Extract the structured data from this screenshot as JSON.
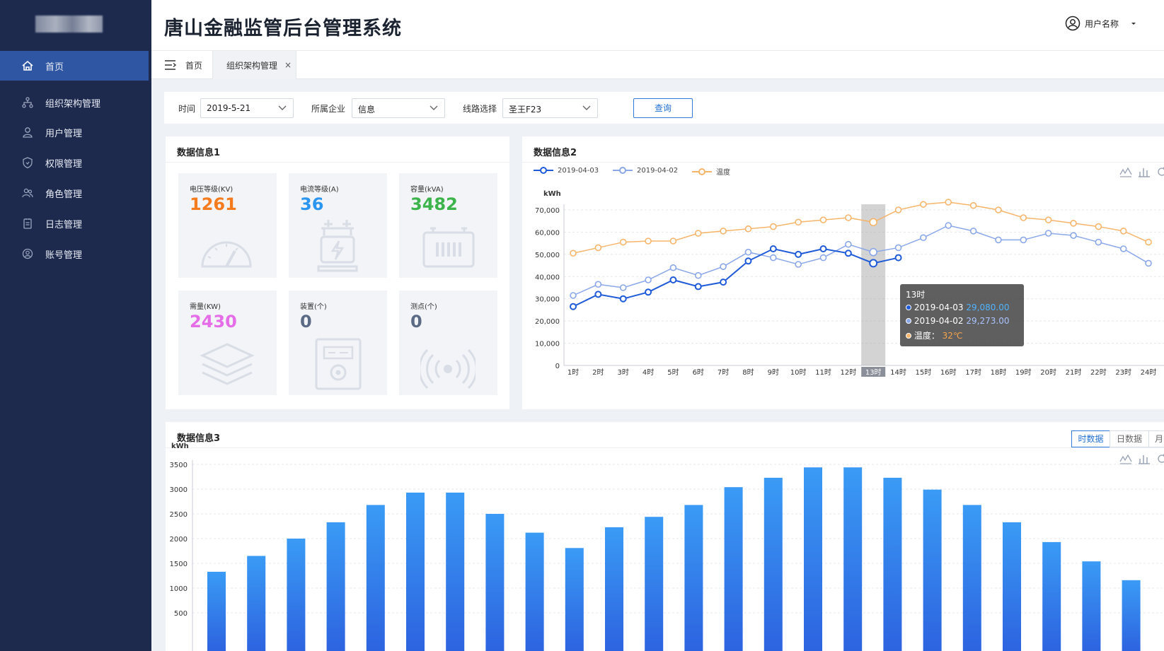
{
  "app": {
    "title": "唐山金融监管后台管理系统",
    "user_name": "用户名称"
  },
  "sidebar": {
    "items": [
      {
        "label": "首页",
        "icon": "home-icon",
        "active": true
      },
      {
        "label": "组织架构管理",
        "icon": "org-chart-icon"
      },
      {
        "label": "用户管理",
        "icon": "user-icon"
      },
      {
        "label": "权限管理",
        "icon": "shield-icon"
      },
      {
        "label": "角色管理",
        "icon": "users-icon"
      },
      {
        "label": "日志管理",
        "icon": "log-icon"
      },
      {
        "label": "账号管理",
        "icon": "account-icon"
      }
    ]
  },
  "tabs": [
    {
      "label": "首页"
    },
    {
      "label": "组织架构管理",
      "active": true
    }
  ],
  "filter": {
    "time_label": "时间",
    "time_value": "2019-5-21",
    "company_label": "所属企业",
    "company_value": "信息",
    "line_label": "线路选择",
    "line_value": "圣王F23",
    "query_label": "查询"
  },
  "panel1": {
    "title": "数据信息1",
    "cards": [
      {
        "label": "电压等级(KV)",
        "value": "1261",
        "color": "#f47c1f",
        "icon": "gauge-icon"
      },
      {
        "label": "电流等级(A)",
        "value": "36",
        "color": "#2b95f0",
        "icon": "transformer-icon"
      },
      {
        "label": "容量(kVA)",
        "value": "3482",
        "color": "#3cb44b",
        "icon": "capacity-icon"
      },
      {
        "label": "需量(KW)",
        "value": "2430",
        "color": "#e56ee8",
        "icon": "layers-icon"
      },
      {
        "label": "装置(个)",
        "value": "0",
        "color": "#5b6b86",
        "icon": "device-icon"
      },
      {
        "label": "测点(个)",
        "value": "0",
        "color": "#5b6b86",
        "icon": "signal-icon"
      }
    ]
  },
  "panel2": {
    "title": "数据信息2",
    "tooltip": {
      "title": "13时",
      "rows": [
        {
          "label": "2019-04-03",
          "value": "29,080.00"
        },
        {
          "label": "2019-04-02",
          "value": "29,273.00"
        },
        {
          "label": "温度：",
          "value": "32℃"
        }
      ]
    }
  },
  "panel3": {
    "title": "数据信息3",
    "segments": [
      {
        "label": "时数据",
        "active": true
      },
      {
        "label": "日数据"
      },
      {
        "label": "月"
      }
    ]
  },
  "chart_data": [
    {
      "type": "line",
      "ylabel": "kWh",
      "ylim": [
        0,
        70000
      ],
      "yticks": [
        "70,000",
        "60,000",
        "50,000",
        "40,000",
        "30,000",
        "20,000",
        "10,000",
        "0"
      ],
      "x": [
        "1时",
        "2时",
        "3时",
        "4时",
        "5时",
        "6时",
        "7时",
        "8时",
        "9时",
        "10时",
        "11时",
        "12时",
        "13时",
        "14时",
        "15时",
        "16时",
        "17时",
        "18时",
        "19时",
        "20时",
        "21时",
        "22时",
        "23时",
        "24时"
      ],
      "highlight": "13时",
      "series": [
        {
          "name": "2019-04-03",
          "color": "#1f5bd8",
          "values": [
            26500,
            32000,
            30000,
            33000,
            38500,
            35500,
            37500,
            47000,
            52500,
            50000,
            52500,
            50500,
            46000,
            48500
          ]
        },
        {
          "name": "2019-04-02",
          "color": "#8aa7e8",
          "values": [
            31500,
            36500,
            35000,
            38500,
            44000,
            40500,
            44500,
            51000,
            48500,
            45500,
            48500,
            54500,
            51000,
            53000,
            57500,
            63000,
            60500,
            56500,
            56500,
            59500,
            58500,
            55500,
            52500,
            46000
          ]
        },
        {
          "name": "温度",
          "color": "#f6b56b",
          "values": [
            50500,
            53000,
            55500,
            56000,
            56000,
            59500,
            60500,
            61500,
            62500,
            64500,
            65500,
            66500,
            64500,
            70000,
            72500,
            73500,
            72000,
            70000,
            66500,
            65500,
            64000,
            62500,
            60500,
            55500
          ]
        }
      ]
    },
    {
      "type": "bar",
      "ylabel": "kWh",
      "ylim": [
        500,
        3500
      ],
      "yticks": [
        "3500",
        "3000",
        "2500",
        "2000",
        "1500",
        "1000",
        "500"
      ],
      "values": [
        1330,
        1650,
        2000,
        2330,
        2680,
        2930,
        2930,
        2500,
        2120,
        1810,
        2230,
        2440,
        2680,
        3040,
        3230,
        3440,
        3440,
        3230,
        2990,
        2680,
        2330,
        1930,
        1540,
        1160
      ]
    }
  ]
}
